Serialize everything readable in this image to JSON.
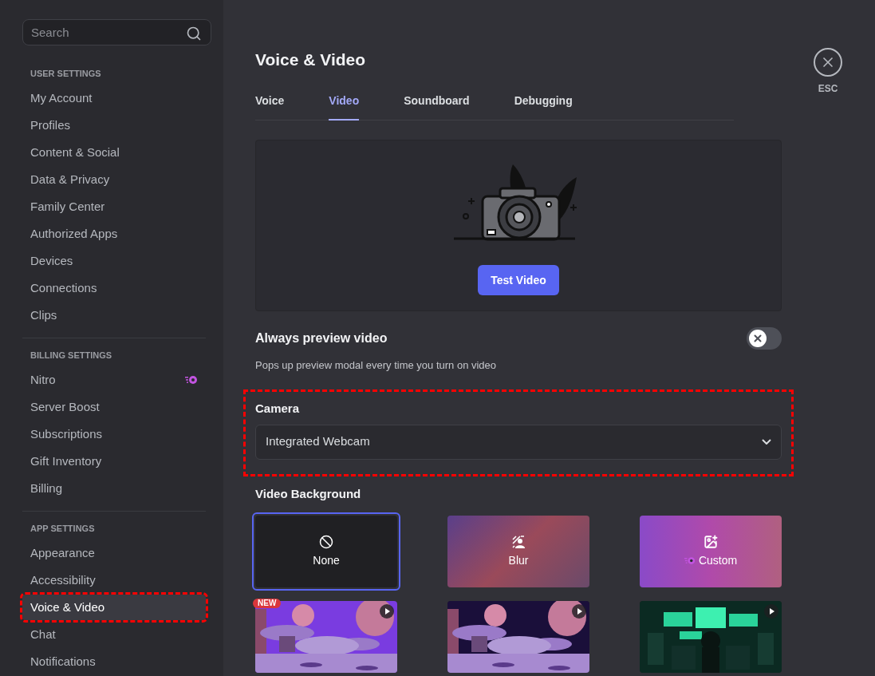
{
  "sidebar": {
    "search": {
      "placeholder": "Search"
    },
    "sections": [
      {
        "title": "USER SETTINGS",
        "items": [
          {
            "label": "My Account",
            "selected": false,
            "highlighted": false
          },
          {
            "label": "Profiles",
            "selected": false,
            "highlighted": false
          },
          {
            "label": "Content & Social",
            "selected": false,
            "highlighted": false
          },
          {
            "label": "Data & Privacy",
            "selected": false,
            "highlighted": false
          },
          {
            "label": "Family Center",
            "selected": false,
            "highlighted": false
          },
          {
            "label": "Authorized Apps",
            "selected": false,
            "highlighted": false
          },
          {
            "label": "Devices",
            "selected": false,
            "highlighted": false
          },
          {
            "label": "Connections",
            "selected": false,
            "highlighted": false
          },
          {
            "label": "Clips",
            "selected": false,
            "highlighted": false
          }
        ]
      },
      {
        "title": "BILLING SETTINGS",
        "items": [
          {
            "label": "Nitro",
            "selected": false,
            "highlighted": false,
            "nitro": true
          },
          {
            "label": "Server Boost",
            "selected": false,
            "highlighted": false
          },
          {
            "label": "Subscriptions",
            "selected": false,
            "highlighted": false
          },
          {
            "label": "Gift Inventory",
            "selected": false,
            "highlighted": false
          },
          {
            "label": "Billing",
            "selected": false,
            "highlighted": false
          }
        ]
      },
      {
        "title": "APP SETTINGS",
        "items": [
          {
            "label": "Appearance",
            "selected": false,
            "highlighted": false
          },
          {
            "label": "Accessibility",
            "selected": false,
            "highlighted": false
          },
          {
            "label": "Voice & Video",
            "selected": true,
            "highlighted": true
          },
          {
            "label": "Chat",
            "selected": false,
            "highlighted": false
          },
          {
            "label": "Notifications",
            "selected": false,
            "highlighted": false
          }
        ]
      }
    ]
  },
  "page": {
    "title": "Voice & Video",
    "tabs": [
      {
        "label": "Voice",
        "selected": false
      },
      {
        "label": "Video",
        "selected": true
      },
      {
        "label": "Soundboard",
        "selected": false
      },
      {
        "label": "Debugging",
        "selected": false
      }
    ],
    "preview": {
      "button": "Test Video"
    },
    "always_preview": {
      "label": "Always preview video",
      "description": "Pops up preview modal every time you turn on video",
      "on": false
    },
    "camera": {
      "label": "Camera",
      "value": "Integrated Webcam",
      "highlighted": true
    },
    "video_background": {
      "label": "Video Background",
      "options": [
        {
          "kind": "none",
          "label": "None",
          "selected": true
        },
        {
          "kind": "blur",
          "label": "Blur",
          "selected": false
        },
        {
          "kind": "custom",
          "label": "Custom",
          "selected": false
        },
        {
          "kind": "video",
          "badge": "NEW",
          "selected": false
        },
        {
          "kind": "video",
          "selected": false
        },
        {
          "kind": "video",
          "selected": false
        }
      ]
    }
  },
  "close": {
    "label": "ESC"
  }
}
